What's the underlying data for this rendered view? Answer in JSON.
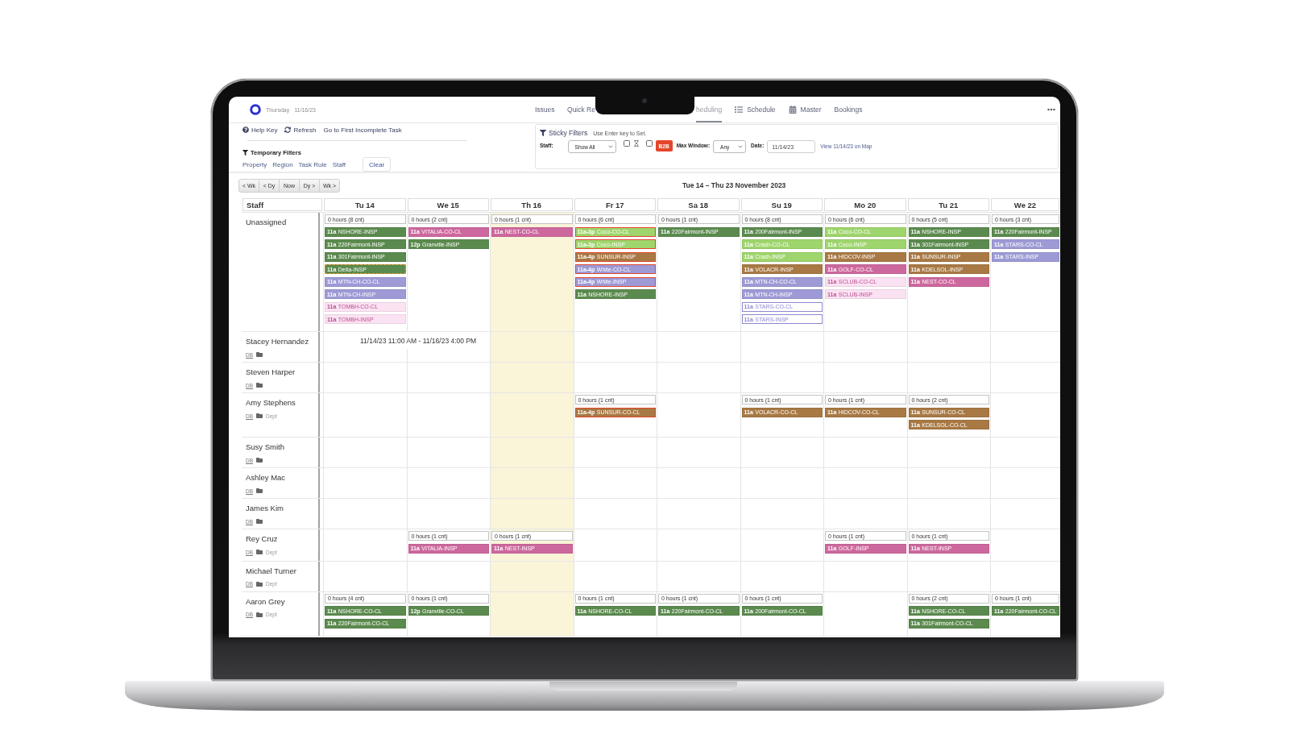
{
  "header": {
    "day": "Thursday",
    "date": "11/16/23",
    "tabs": [
      {
        "label": "Issues",
        "selected": false
      },
      {
        "label": "Quick Re",
        "selected": false
      },
      {
        "label": "heduling",
        "selected": true
      },
      {
        "label": "Schedule",
        "selected": false
      },
      {
        "label": "Master",
        "selected": false
      },
      {
        "label": "Bookings",
        "selected": false
      }
    ]
  },
  "actions": [
    "Help Key",
    "Refresh",
    "Go to First Incomplete Task"
  ],
  "temporary_filters": {
    "title": "Temporary Filters",
    "links": [
      "Property",
      "Region",
      "Task Rule",
      "Staff"
    ],
    "clear": "Clear"
  },
  "sticky_filters": {
    "title": "Sticky Filters",
    "hint": "Use Enter key to Set.",
    "staff_label": "Staff:",
    "staff_value": "Show All",
    "hourglass_checked": false,
    "b2b_checked": false,
    "b2b_label": "B2B",
    "max_window_label": "Max Window:",
    "max_window_value": "Any",
    "date_label": "Date:",
    "date_value": "11/14/23",
    "map_link": "View 11/14/23 on Map"
  },
  "date_nav": [
    "< Wk",
    "< Dy",
    "Now",
    "Dy >",
    "Wk >"
  ],
  "range_title": "Tue 14 – Thu 23 November 2023",
  "grid": {
    "staff_heading": "Staff",
    "days": [
      {
        "label": "Tu 14",
        "today": false
      },
      {
        "label": "We 15",
        "today": false
      },
      {
        "label": "Th 16",
        "today": true
      },
      {
        "label": "Fr 17",
        "today": false
      },
      {
        "label": "Sa 18",
        "today": false
      },
      {
        "label": "Su 19",
        "today": false
      },
      {
        "label": "Mo 20",
        "today": false
      },
      {
        "label": "Tu 21",
        "today": false
      },
      {
        "label": "We 22",
        "today": false
      }
    ],
    "rows": [
      {
        "name": "Unassigned",
        "cells": [
          {
            "hours": "0 hours (8 cnt)",
            "events": [
              {
                "time": "11a",
                "name": "NSHORE-INSP",
                "color": "#5b8a4e"
              },
              {
                "time": "11a",
                "name": "220Fairmont-INSP",
                "color": "#5b8a4e"
              },
              {
                "time": "11a",
                "name": "301Fairmont-INSP",
                "color": "#5b8a4e"
              },
              {
                "time": "11a",
                "name": "Delta-INSP",
                "color": "#5b8a4e",
                "warning": true
              },
              {
                "time": "11a",
                "name": "MTN-CH-CO-CL",
                "color": "#9d9ad6"
              },
              {
                "time": "11a",
                "name": "MTN-CH-INSP",
                "color": "#9d9ad6"
              },
              {
                "time": "11a",
                "name": "TOMBH-CO-CL",
                "color": "#fbe2f3",
                "faded": true
              },
              {
                "time": "11a",
                "name": "TOMBH-INSP",
                "color": "#fbe2f3",
                "faded": true
              }
            ]
          },
          {
            "hours": "0 hours (2 cnt)",
            "events": [
              {
                "time": "11a",
                "name": "VITALIA-CO-CL",
                "color": "#cd689e"
              },
              {
                "time": "12p",
                "name": "Granville-INSP",
                "color": "#5b8a4e"
              }
            ]
          },
          {
            "hours": "0 hours (1 cnt)",
            "events": [
              {
                "time": "11a",
                "name": "NEST-CO-CL",
                "color": "#cd689e"
              }
            ]
          },
          {
            "hours": "0 hours (6 cnt)",
            "events": [
              {
                "time": "11a-3p",
                "name": "Coco-CO-CL",
                "color": "#9ed56c",
                "conflict": true
              },
              {
                "time": "11a-3p",
                "name": "Coco-INSP",
                "color": "#9ed56c",
                "conflict": true
              },
              {
                "time": "11a-4p",
                "name": "SUNSUR-INSP",
                "color": "#a87944",
                "conflict": true
              },
              {
                "time": "11a-4p",
                "name": "White-CO-CL",
                "color": "#9d9ad6",
                "conflict": true
              },
              {
                "time": "11a-4p",
                "name": "White-INSP",
                "color": "#9d9ad6",
                "conflict": true
              },
              {
                "time": "11a",
                "name": "NSHORE-INSP",
                "color": "#5b8a4e"
              }
            ]
          },
          {
            "hours": "0 hours (1 cnt)",
            "events": [
              {
                "time": "11a",
                "name": "220Fairmont-INSP",
                "color": "#5b8a4e"
              }
            ]
          },
          {
            "hours": "0 hours (8 cnt)",
            "events": [
              {
                "time": "11a",
                "name": "200Fairmont-INSP",
                "color": "#5b8a4e"
              },
              {
                "time": "11a",
                "name": "Crash-CO-CL",
                "color": "#9ed56c"
              },
              {
                "time": "11a",
                "name": "Crash-INSP",
                "color": "#9ed56c"
              },
              {
                "time": "11a",
                "name": "VOLACR-INSP",
                "color": "#a87944"
              },
              {
                "time": "11a",
                "name": "MTN-CH-CO-CL",
                "color": "#9d9ad6"
              },
              {
                "time": "11a",
                "name": "MTN-CH-INSP",
                "color": "#9d9ad6"
              },
              {
                "time": "11a",
                "name": "STARS-CO-CL",
                "color": "#8d89d0",
                "outline": true
              },
              {
                "time": "11a",
                "name": "STARS-INSP",
                "color": "#8d89d0",
                "outline": true
              }
            ]
          },
          {
            "hours": "0 hours (6 cnt)",
            "events": [
              {
                "time": "11a",
                "name": "Coco-CO-CL",
                "color": "#9ed56c"
              },
              {
                "time": "11a",
                "name": "Coco-INSP",
                "color": "#9ed56c"
              },
              {
                "time": "11a",
                "name": "HIDCOV-INSP",
                "color": "#a87944"
              },
              {
                "time": "11a",
                "name": "GOLF-CO-CL",
                "color": "#cd689e"
              },
              {
                "time": "11a",
                "name": "SCLUB-CO-CL",
                "color": "#fbe2f3",
                "faded": true
              },
              {
                "time": "11a",
                "name": "SCLUB-INSP",
                "color": "#fbe2f3",
                "faded": true
              }
            ]
          },
          {
            "hours": "0 hours (5 cnt)",
            "events": [
              {
                "time": "11a",
                "name": "NSHORE-INSP",
                "color": "#5b8a4e"
              },
              {
                "time": "11a",
                "name": "301Fairmont-INSP",
                "color": "#5b8a4e"
              },
              {
                "time": "11a",
                "name": "SUNSUR-INSP",
                "color": "#a87944"
              },
              {
                "time": "11a",
                "name": "KDELSOL-INSP",
                "color": "#a87944"
              },
              {
                "time": "11a",
                "name": "NEST-CO-CL",
                "color": "#cd689e"
              }
            ]
          },
          {
            "hours": "0 hours (3 cnt)",
            "events": [
              {
                "time": "11a",
                "name": "220Fairmont-INSP",
                "color": "#5b8a4e"
              },
              {
                "time": "11a",
                "name": "STARS-CO-CL",
                "color": "#9d9ad6"
              },
              {
                "time": "11a",
                "name": "STARS-INSP",
                "color": "#9d9ad6"
              }
            ]
          }
        ]
      },
      {
        "name": "Stacey Hernandez",
        "db": "DB",
        "tooltip": "11/14/23 11:00 AM - 11/16/23 4:00 PM"
      },
      {
        "name": "Steven Harper",
        "db": "DB"
      },
      {
        "name": "Amy Stephens",
        "db": "DB",
        "dept": "Dept",
        "cells": [
          {},
          {},
          {},
          {
            "hours": "0 hours (1 cnt)",
            "events": [
              {
                "time": "11a-4p",
                "name": "SUNSUR-CO-CL",
                "color": "#a87944",
                "conflict": true
              }
            ]
          },
          {},
          {
            "hours": "0 hours (1 cnt)",
            "events": [
              {
                "time": "11a",
                "name": "VOLACR-CO-CL",
                "color": "#a87944"
              }
            ]
          },
          {
            "hours": "0 hours (1 cnt)",
            "events": [
              {
                "time": "11a",
                "name": "HIDCOV-CO-CL",
                "color": "#a87944"
              }
            ]
          },
          {
            "hours": "0 hours (2 cnt)",
            "events": [
              {
                "time": "11a",
                "name": "SUNSUR-CO-CL",
                "color": "#a87944"
              },
              {
                "time": "11a",
                "name": "KDELSOL-CO-CL",
                "color": "#a87944"
              }
            ]
          },
          {}
        ]
      },
      {
        "name": "Susy Smith",
        "db": "DB"
      },
      {
        "name": "Ashley Mac",
        "db": "DB"
      },
      {
        "name": "James Kim",
        "db": "DB"
      },
      {
        "name": "Rey Cruz",
        "db": "DB",
        "dept": "Dept",
        "cells": [
          {},
          {
            "hours": "0 hours (1 cnt)",
            "events": [
              {
                "time": "11a",
                "name": "VITALIA-INSP",
                "color": "#cd689e"
              }
            ]
          },
          {
            "hours": "0 hours (1 cnt)",
            "events": [
              {
                "time": "11a",
                "name": "NEST-INSP",
                "color": "#cd689e"
              }
            ]
          },
          {},
          {},
          {},
          {
            "hours": "0 hours (1 cnt)",
            "events": [
              {
                "time": "11a",
                "name": "GOLF-INSP",
                "color": "#cd689e"
              }
            ]
          },
          {
            "hours": "0 hours (1 cnt)",
            "events": [
              {
                "time": "11a",
                "name": "NEST-INSP",
                "color": "#cd689e"
              }
            ]
          },
          {}
        ]
      },
      {
        "name": "Michael Turner",
        "db": "DB",
        "dept": "Dept"
      },
      {
        "name": "Aaron Grey",
        "db": "DB",
        "dept": "Dept",
        "cells": [
          {
            "hours": "0 hours (4 cnt)",
            "events": [
              {
                "time": "11a",
                "name": "NSHORE-CO-CL",
                "color": "#5b8a4e"
              },
              {
                "time": "11a",
                "name": "220Fairmont-CO-CL",
                "color": "#5b8a4e"
              }
            ]
          },
          {
            "hours": "0 hours (1 cnt)",
            "events": [
              {
                "time": "12p",
                "name": "Granville-CO-CL",
                "color": "#5b8a4e"
              }
            ]
          },
          {},
          {
            "hours": "0 hours (1 cnt)",
            "events": [
              {
                "time": "11a",
                "name": "NSHORE-CO-CL",
                "color": "#5b8a4e"
              }
            ]
          },
          {
            "hours": "0 hours (1 cnt)",
            "events": [
              {
                "time": "11a",
                "name": "220Fairmont-CO-CL",
                "color": "#5b8a4e"
              }
            ]
          },
          {
            "hours": "0 hours (1 cnt)",
            "events": [
              {
                "time": "11a",
                "name": "200Fairmont-CO-CL",
                "color": "#5b8a4e"
              }
            ]
          },
          {},
          {
            "hours": "0 hours (2 cnt)",
            "events": [
              {
                "time": "11a",
                "name": "NSHORE-CO-CL",
                "color": "#5b8a4e"
              },
              {
                "time": "11a",
                "name": "301Fairmont-CO-CL",
                "color": "#5b8a4e"
              }
            ]
          },
          {
            "hours": "0 hours (1 cnt)",
            "events": [
              {
                "time": "11a",
                "name": "220Fairmont-CO-CL",
                "color": "#5b8a4e"
              }
            ]
          }
        ]
      }
    ]
  }
}
